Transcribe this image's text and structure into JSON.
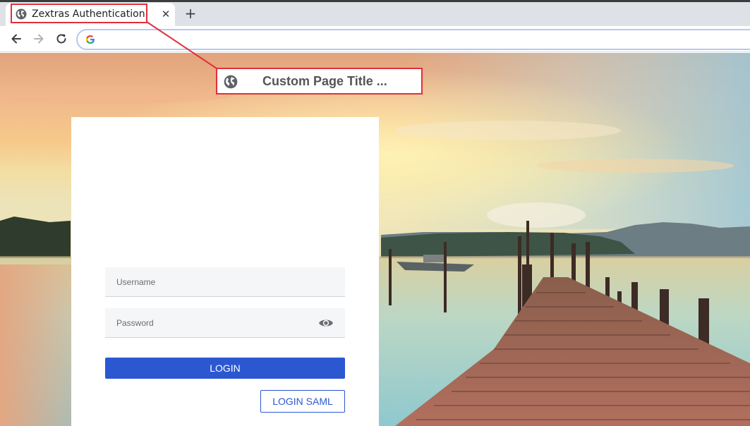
{
  "browser": {
    "tab_title": "Zextras Authentication",
    "tab_close": "✕",
    "new_tab": "+"
  },
  "callout": {
    "text": "Custom Page Title ..."
  },
  "login": {
    "username_placeholder": "Username",
    "password_placeholder": "Password",
    "login_label": "LOGIN",
    "saml_label": "LOGIN SAML"
  },
  "colors": {
    "accent": "#2b58d1",
    "highlight": "#e0303a"
  },
  "icons": {
    "globe": "globe-icon",
    "eye": "eye-icon",
    "back": "arrow-back-icon",
    "forward": "arrow-forward-icon",
    "reload": "reload-icon",
    "google": "google-g-icon"
  }
}
